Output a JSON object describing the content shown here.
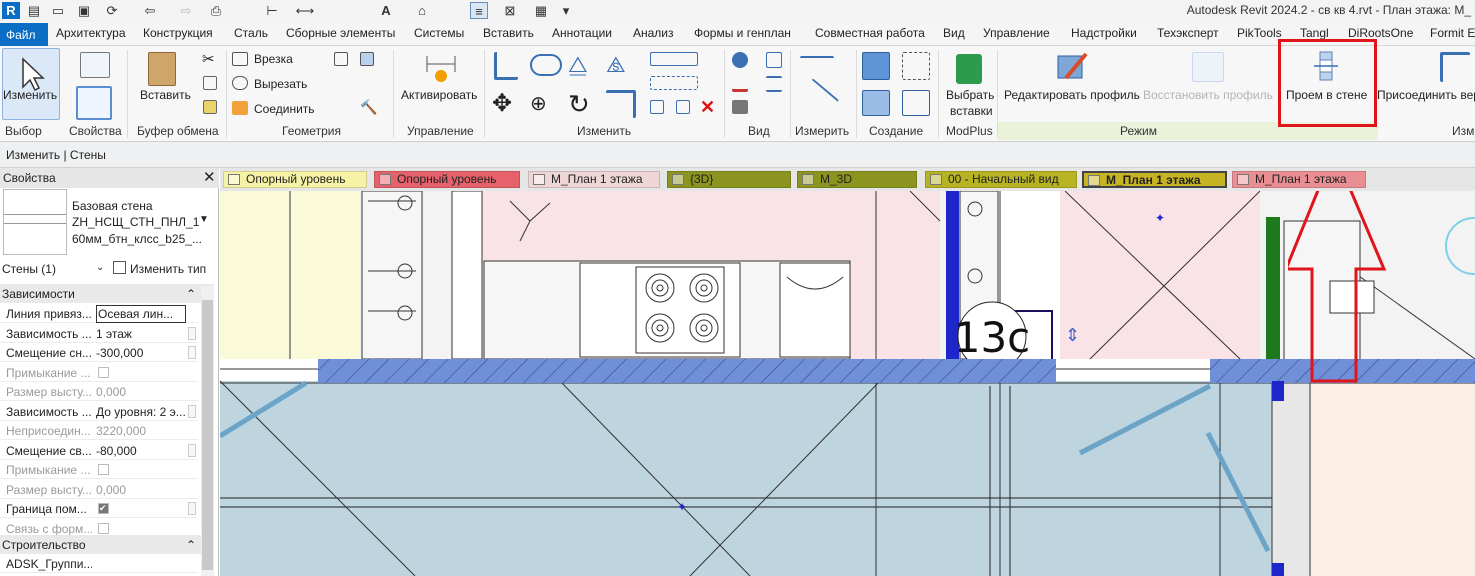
{
  "app": {
    "title": "Autodesk Revit 2024.2 - св кв 4.rvt - План этажа: М_",
    "logo_letter": "R"
  },
  "ribbon_tabs": [
    "Файл",
    "Архитектура",
    "Конструкция",
    "Сталь",
    "Сборные элементы",
    "Системы",
    "Вставить",
    "Аннотации",
    "Анализ",
    "Формы и генплан",
    "Совместная работа",
    "Вид",
    "Управление",
    "Надстройки",
    "Техэксперт",
    "PikTools",
    "Tangl",
    "DiRootsOne",
    "Formit E"
  ],
  "ribbon": {
    "modify_label": "Изменить",
    "paste_label": "Вставить",
    "cut_label": "Врезка",
    "cut2_label": "Вырезать",
    "join_label": "Соединить",
    "activate_label": "Активировать",
    "select_inserts_line1": "Выбрать",
    "select_inserts_line2": "вставки",
    "edit_profile_label": "Редактировать профиль",
    "restore_profile_label": "Восстановить профиль",
    "wall_opening_label": "Проем в стене",
    "attach_label": "Присоединить вер",
    "panels": [
      "Выбор",
      "Свойства",
      "Буфер обмена",
      "Геометрия",
      "Управление",
      "Изменить",
      "Вид",
      "Измерить",
      "Создание",
      "ModPlus",
      "Режим",
      "Изм"
    ]
  },
  "context_bar": "Изменить | Стены",
  "properties": {
    "title": "Свойства",
    "type_line1": "Базовая стена",
    "type_line2": "ZH_НСЩ_СТН_ПНЛ_1",
    "type_line3": "60мм_бтн_клсс_b25_...",
    "selector": "Стены (1)",
    "edit_type": "Изменить тип",
    "groups": [
      "Зависимости",
      "Строительство"
    ],
    "rows": [
      {
        "k": "Линия привяз...",
        "v": "Осевая лин...",
        "dis": false,
        "boxed": true
      },
      {
        "k": "Зависимость ...",
        "v": "1 этаж",
        "dis": false
      },
      {
        "k": "Смещение сн...",
        "v": "-300,000",
        "dis": false
      },
      {
        "k": "Примыкание ...",
        "v": "",
        "dis": true,
        "chk": "off"
      },
      {
        "k": "Размер высту...",
        "v": "0,000",
        "dis": true
      },
      {
        "k": "Зависимость ...",
        "v": "До уровня: 2 э...",
        "dis": false
      },
      {
        "k": "Неприсоедин...",
        "v": "3220,000",
        "dis": true
      },
      {
        "k": "Смещение св...",
        "v": "-80,000",
        "dis": false
      },
      {
        "k": "Примыкание ...",
        "v": "",
        "dis": true,
        "chk": "off"
      },
      {
        "k": "Размер высту...",
        "v": "0,000",
        "dis": true
      },
      {
        "k": "Граница пом...",
        "v": "",
        "dis": false,
        "chk": "on"
      },
      {
        "k": "Связь с форм...",
        "v": "",
        "dis": true,
        "chk": "off"
      }
    ],
    "construction_row": "ADSK_Группи..."
  },
  "view_tabs": [
    {
      "label": "Опорный уровень",
      "color": "#f7f3a6"
    },
    {
      "label": "Опорный уровень",
      "color": "#e5616b"
    },
    {
      "label": "М_План 1 этажа",
      "color": "#efd6d6"
    },
    {
      "label": "{3D}",
      "color": "#8c9420"
    },
    {
      "label": "М_3D",
      "color": "#8c9420"
    },
    {
      "label": "00 - Начальный вид",
      "color": "#b7b322"
    },
    {
      "label": "М_План 1 этажа",
      "color": "#c7b424",
      "active": true
    },
    {
      "label": "М_План 1 этажа",
      "color": "#e98f94"
    }
  ],
  "drawing": {
    "room_tag": "13с"
  },
  "colors": {
    "accent_blue": "#0a6fc4",
    "highlight_red": "#e0141b"
  },
  "icons": [
    "modify-arrow-icon",
    "paste-icon",
    "scissors-icon",
    "activate-icon",
    "move-icon",
    "rotate-icon",
    "measure-icon",
    "create-icon",
    "modplus-icon",
    "edit-profile-icon",
    "wall-opening-icon",
    "attach-icon"
  ]
}
